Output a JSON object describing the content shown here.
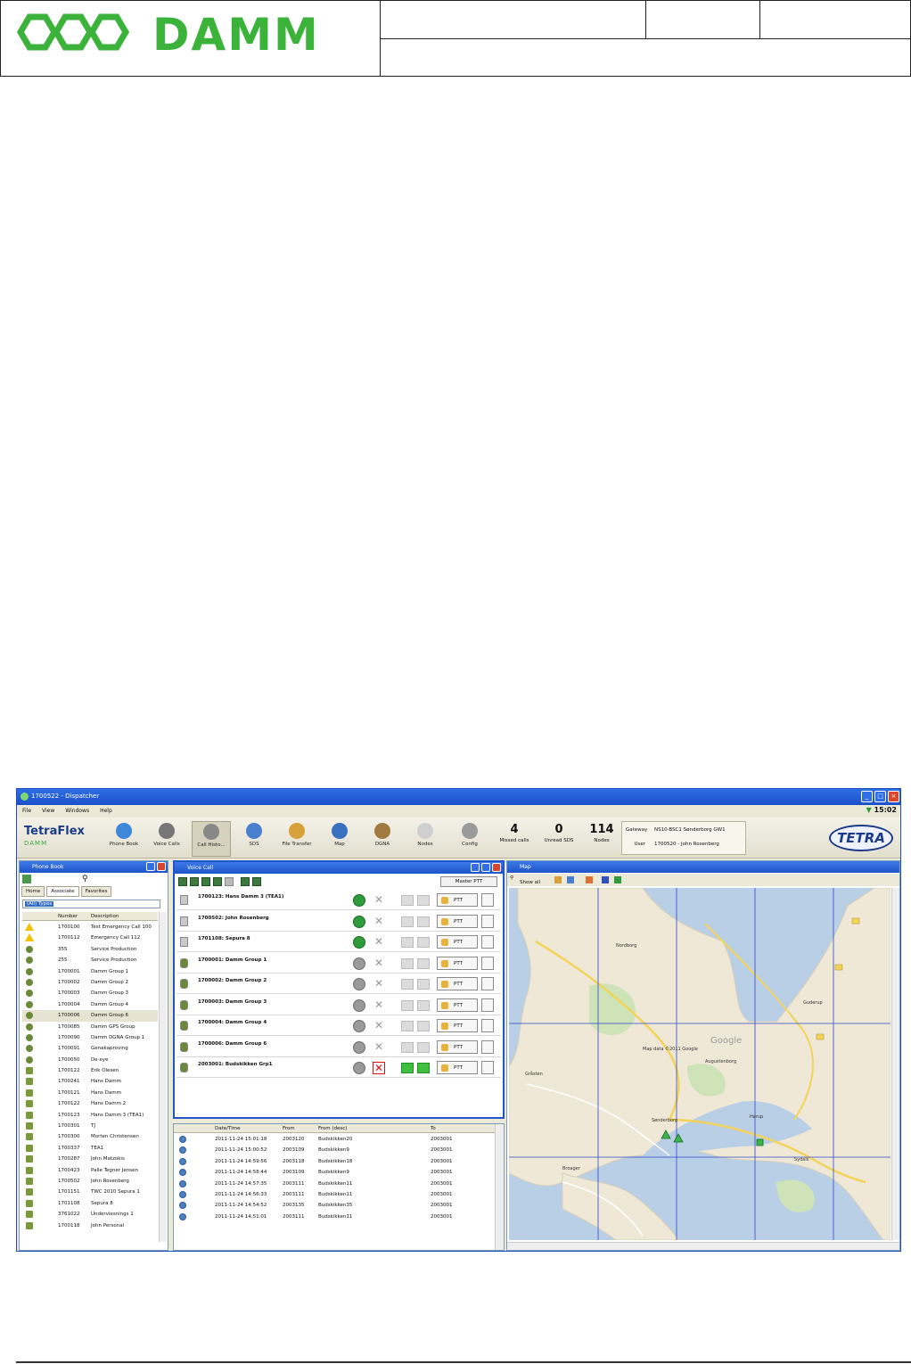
{
  "document": {
    "logo_text": "DAMM"
  },
  "app": {
    "title": "1700522 - Dispatcher",
    "menu": [
      "File",
      "View",
      "Windows",
      "Help"
    ],
    "clock": "15:02",
    "brand": "TetraFlex",
    "brand_sub": "DAMM",
    "toolbar": [
      {
        "label": "Phone Book",
        "icon": "phone-book-icon",
        "color": "#3d88d8"
      },
      {
        "label": "Voice Calls",
        "icon": "headset-icon",
        "color": "#777777"
      },
      {
        "label": "Call Histo...",
        "icon": "call-history-icon",
        "color": "#888888"
      },
      {
        "label": "SDS",
        "icon": "sds-icon",
        "color": "#4a7fd0"
      },
      {
        "label": "File Transfer",
        "icon": "file-transfer-icon",
        "color": "#d6a03a"
      },
      {
        "label": "Map",
        "icon": "globe-icon",
        "color": "#3a70c0"
      },
      {
        "label": "DGNA",
        "icon": "dgna-icon",
        "color": "#a07a40"
      },
      {
        "label": "Nodes",
        "icon": "nodes-icon",
        "color": "#cfcfcf"
      },
      {
        "label": "Config",
        "icon": "gear-icon",
        "color": "#9a9a9a"
      }
    ],
    "counters": [
      {
        "value": "4",
        "label": "Missed calls"
      },
      {
        "value": "0",
        "label": "Unread SDS"
      },
      {
        "value": "114",
        "label": "Nodes"
      }
    ],
    "gateway_label": "Gateway",
    "gateway_value": "NS10-BSC1 Sønderborg GW1",
    "user_label": "User",
    "user_value": "1700520 - John Rosenberg",
    "tetra_logo": "TETRA"
  },
  "phonebook": {
    "title": "Phone Book",
    "tabs": [
      "Home",
      "Associate",
      "Favorites"
    ],
    "filter": "(All) Types",
    "columns": [
      "Number",
      "Description"
    ],
    "rows": [
      {
        "number": "1700100",
        "desc": "Test Emergency Call 100",
        "icon": "warning"
      },
      {
        "number": "1700112",
        "desc": "Emergency Call 112",
        "icon": "warning"
      },
      {
        "number": "355",
        "desc": "Service Production",
        "icon": "group"
      },
      {
        "number": "255",
        "desc": "Service Production",
        "icon": "group"
      },
      {
        "number": "1700001",
        "desc": "Damm Group 1",
        "icon": "group"
      },
      {
        "number": "1700002",
        "desc": "Damm Group 2",
        "icon": "group"
      },
      {
        "number": "1700003",
        "desc": "Damm Group 3",
        "icon": "group"
      },
      {
        "number": "1700004",
        "desc": "Damm Group 4",
        "icon": "group"
      },
      {
        "number": "1700006",
        "desc": "Damm Group 6",
        "icon": "group",
        "highlight": true
      },
      {
        "number": "1700085",
        "desc": "Damm GPS Group",
        "icon": "group"
      },
      {
        "number": "1700090",
        "desc": "Damm DGNA Group 1",
        "icon": "group"
      },
      {
        "number": "1700091",
        "desc": "Genakaproving",
        "icon": "group"
      },
      {
        "number": "1700050",
        "desc": "De eye",
        "icon": "group"
      },
      {
        "number": "1700122",
        "desc": "Erik Olesen",
        "icon": "terminal"
      },
      {
        "number": "1700241",
        "desc": "Hans Damm",
        "icon": "terminal"
      },
      {
        "number": "1700121",
        "desc": "Hans Damm",
        "icon": "terminal"
      },
      {
        "number": "1700122",
        "desc": "Hans Damm 2",
        "icon": "terminal"
      },
      {
        "number": "1700123",
        "desc": "Hans Damm 3 (TEA1)",
        "icon": "terminal"
      },
      {
        "number": "1700301",
        "desc": "TJ",
        "icon": "terminal"
      },
      {
        "number": "1700300",
        "desc": "Morten Christensen",
        "icon": "terminal"
      },
      {
        "number": "1700337",
        "desc": "TEA1",
        "icon": "terminal"
      },
      {
        "number": "1700287",
        "desc": "John Matzokis",
        "icon": "terminal"
      },
      {
        "number": "1700423",
        "desc": "Palle Tegner Jensen",
        "icon": "terminal"
      },
      {
        "number": "1700502",
        "desc": "John Rosenberg",
        "icon": "terminal"
      },
      {
        "number": "1701151",
        "desc": "TWC 2010 Sepura 1",
        "icon": "terminal"
      },
      {
        "number": "1701108",
        "desc": "Sepura 8",
        "icon": "terminal"
      },
      {
        "number": "3761022",
        "desc": "Underviesnings 1",
        "icon": "terminal"
      },
      {
        "number": "1700118",
        "desc": "John Personal",
        "icon": "terminal"
      }
    ]
  },
  "voicecall": {
    "title": "Voice Call",
    "master_ptt": "Master PTT",
    "ptt_label": "PTT",
    "rows": [
      {
        "name": "1700123:  Hans Damm 3 (TEA1)",
        "active": true,
        "type": "terminal"
      },
      {
        "name": "1700502:  John Rosenberg",
        "active": true,
        "type": "terminal"
      },
      {
        "name": "1701108:  Sepura 8",
        "active": true,
        "type": "terminal"
      },
      {
        "name": "1700001:  Damm Group 1",
        "active": false,
        "type": "group"
      },
      {
        "name": "1700002:  Damm Group 2",
        "active": false,
        "type": "group"
      },
      {
        "name": "1700003:  Damm Group 3",
        "active": false,
        "type": "group"
      },
      {
        "name": "1700004:  Damm Group 4",
        "active": false,
        "type": "group"
      },
      {
        "name": "1700006:  Damm Group 6",
        "active": false,
        "type": "group"
      },
      {
        "name": "2003001:  Budskikken Grp1",
        "active": false,
        "type": "group",
        "special": true
      }
    ]
  },
  "calllog": {
    "columns": [
      "Date/Time",
      "From",
      "From (desc)",
      "To"
    ],
    "rows": [
      {
        "dt": "2011-11-24  15:01:18",
        "from": "2003120",
        "fromd": "Budskikken20",
        "to": "2003001"
      },
      {
        "dt": "2011-11-24  15:00:52",
        "from": "2003109",
        "fromd": "Budskikken9",
        "to": "2003001"
      },
      {
        "dt": "2011-11-24  14:59:56",
        "from": "2003118",
        "fromd": "Budskikken18",
        "to": "2003001"
      },
      {
        "dt": "2011-11-24  14:58:44",
        "from": "2003109",
        "fromd": "Budskikken9",
        "to": "2003001"
      },
      {
        "dt": "2011-11-24  14:57:35",
        "from": "2003111",
        "fromd": "Budskikken11",
        "to": "2003001"
      },
      {
        "dt": "2011-11-24  14:56:33",
        "from": "2003111",
        "fromd": "Budskikken11",
        "to": "2003001"
      },
      {
        "dt": "2011-11-24  14:54:52",
        "from": "2003135",
        "fromd": "Budskikken35",
        "to": "2003001"
      },
      {
        "dt": "2011-11-24  14:51:01",
        "from": "2003111",
        "fromd": "Budskikken11",
        "to": "2003001"
      }
    ]
  },
  "map": {
    "title": "Map",
    "tool_label": "Show all",
    "attribution": "Map data ©2011 Google",
    "watermark": "Google",
    "places": [
      "Nordborg",
      "Guderup",
      "Sønderborg",
      "Augustenborg",
      "Hørup",
      "Broager",
      "Gråsten",
      "Sydals"
    ]
  }
}
